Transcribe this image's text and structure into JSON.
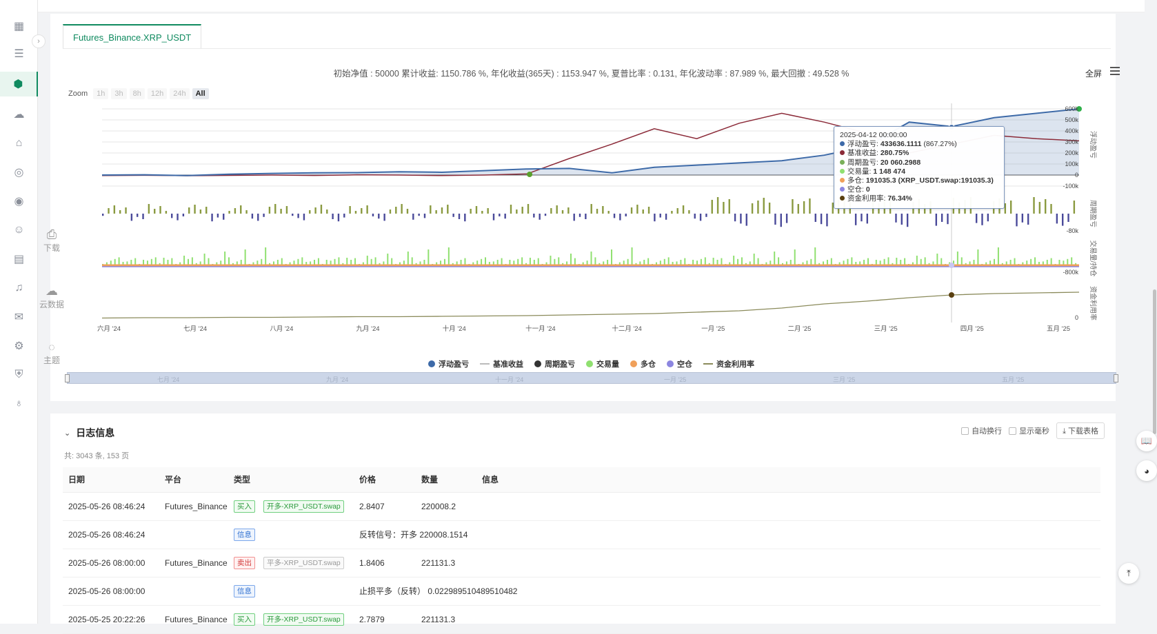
{
  "tab": {
    "label": "Futures_Binance.XRP_USDT"
  },
  "summary": "初始净值 : 50000 累计收益: 1150.786 %, 年化收益(365天) : 1153.947 %, 夏普比率 : 0.131, 年化波动率 : 87.989 %, 最大回撤 : 49.528 %",
  "fullscreen_label": "全屏",
  "zoom": {
    "label": "Zoom",
    "buttons": [
      "1h",
      "3h",
      "8h",
      "12h",
      "24h",
      "All"
    ],
    "selected": "All"
  },
  "side_actions": {
    "download": "下载",
    "cloud": "云数据",
    "theme": "主题"
  },
  "chart_data": {
    "type": "line",
    "x": [
      "六月 '24",
      "七月 '24",
      "八月 '24",
      "九月 '24",
      "十月 '24",
      "十一月 '24",
      "十二月 '24",
      "一月 '25",
      "二月 '25",
      "三月 '25",
      "四月 '25",
      "五月 '25"
    ],
    "panes": [
      {
        "name": "浮动盈亏",
        "ticks": [
          "600k",
          "500k",
          "400k",
          "300k",
          "200k",
          "100k",
          "0",
          "-100k"
        ]
      },
      {
        "name": "周期盈亏",
        "ticks": [
          "-80k"
        ]
      },
      {
        "name": "交易量/持仓",
        "ticks": [
          "-800k"
        ]
      },
      {
        "name": "资金利用率",
        "ticks": [
          "0"
        ]
      }
    ],
    "series": [
      {
        "name": "浮动盈亏",
        "color": "#3d6aa8",
        "values": [
          0,
          2000,
          -5000,
          8000,
          15000,
          20000,
          22000,
          30000,
          25000,
          40000,
          55000,
          60000,
          20000,
          70000,
          90000,
          110000,
          130000,
          180000,
          260000,
          480000,
          440000,
          520000,
          560000,
          600000
        ]
      },
      {
        "name": "基准收益",
        "color": "#8b2a38",
        "values": [
          -5000,
          -2000,
          -6000,
          -3000,
          0,
          -4000,
          2000,
          0,
          -5000,
          0,
          10000,
          150000,
          280000,
          420000,
          330000,
          470000,
          560000,
          480000,
          380000,
          200000,
          280000,
          360000,
          330000,
          310000
        ]
      },
      {
        "name": "周期盈亏",
        "color": "#333333"
      },
      {
        "name": "交易量",
        "color": "#90e070"
      },
      {
        "name": "多仓",
        "color": "#f0a05a"
      },
      {
        "name": "空仓",
        "color": "#8c86e0"
      },
      {
        "name": "资金利用率",
        "color": "#8a8a5a",
        "values": [
          0.01,
          0.02,
          0.02,
          0.03,
          0.03,
          0.04,
          0.05,
          0.05,
          0.06,
          0.07,
          0.08,
          0.1,
          0.12,
          0.14,
          0.18,
          0.22,
          0.3,
          0.42,
          0.5,
          0.6,
          0.68,
          0.72,
          0.74,
          0.76
        ]
      }
    ],
    "tooltip": {
      "date": "2025-04-12 00:00:00",
      "rows": [
        {
          "label": "浮动盈亏",
          "value": "433636.1111",
          "extra": "(867.27%)",
          "color": "#3d6aa8"
        },
        {
          "label": "基准收益",
          "value": "280.75%",
          "extra": "",
          "color": "#8b2a38"
        },
        {
          "label": "周期盈亏",
          "value": "20 060.2988",
          "extra": "",
          "color": "#7ab05a"
        },
        {
          "label": "交易量",
          "value": "1 148 474",
          "extra": "",
          "color": "#90e070"
        },
        {
          "label": "多仓",
          "value": "191035.3",
          "extra": "(XRP_USDT.swap:191035.3)",
          "color": "#f0a05a"
        },
        {
          "label": "空仓",
          "value": "0",
          "extra": "",
          "color": "#8c86e0"
        },
        {
          "label": "资金利用率",
          "value": "76.34%",
          "extra": "",
          "color": "#5a4010"
        }
      ]
    },
    "navigator_labels": [
      "七月 '24",
      "九月 '24",
      "十一月 '24",
      "一月 '25",
      "三月 '25",
      "五月 '25"
    ]
  },
  "legend": [
    {
      "label": "浮动盈亏",
      "color": "#3d6aa8",
      "kind": "dot"
    },
    {
      "label": "基准收益",
      "color": "#bbbbbb",
      "kind": "line"
    },
    {
      "label": "周期盈亏",
      "color": "#333333",
      "kind": "dot"
    },
    {
      "label": "交易量",
      "color": "#90e070",
      "kind": "dot"
    },
    {
      "label": "多仓",
      "color": "#f0a05a",
      "kind": "dot"
    },
    {
      "label": "空仓",
      "color": "#8c86e0",
      "kind": "dot"
    },
    {
      "label": "资金利用率",
      "color": "#8a8a5a",
      "kind": "line"
    }
  ],
  "log": {
    "title": "日志信息",
    "count": "共: 3043 条, 153 页",
    "options": {
      "auto_wrap": "自动换行",
      "show_ms": "显示毫秒",
      "download": "下载表格"
    },
    "columns": [
      "日期",
      "平台",
      "类型",
      "价格",
      "数量",
      "信息"
    ],
    "rows": [
      {
        "date": "2025-05-26 08:46:24",
        "platform": "Futures_Binance",
        "type": "买入",
        "type_kind": "buy",
        "tag2": "开多-XRP_USDT.swap",
        "tag2_kind": "buy",
        "price": "2.8407",
        "qty": "220008.2",
        "info": ""
      },
      {
        "date": "2025-05-26 08:46:24",
        "platform": "",
        "type": "信息",
        "type_kind": "info",
        "tag2": "",
        "tag2_kind": "",
        "price": "反转信号：开多 220008.1514",
        "qty": "",
        "info": ""
      },
      {
        "date": "2025-05-26 08:00:00",
        "platform": "Futures_Binance",
        "type": "卖出",
        "type_kind": "sell",
        "tag2": "平多-XRP_USDT.swap",
        "tag2_kind": "gray",
        "price": "1.8406",
        "qty": "221131.3",
        "info": ""
      },
      {
        "date": "2025-05-26 08:00:00",
        "platform": "",
        "type": "信息",
        "type_kind": "info",
        "tag2": "",
        "tag2_kind": "",
        "price": "止损平多（反转） 0.022989510489510482",
        "qty": "",
        "info": ""
      },
      {
        "date": "2025-05-25 20:22:26",
        "platform": "Futures_Binance",
        "type": "买入",
        "type_kind": "buy",
        "tag2": "开多-XRP_USDT.swap",
        "tag2_kind": "buy",
        "price": "2.7879",
        "qty": "221131.3",
        "info": ""
      }
    ]
  }
}
